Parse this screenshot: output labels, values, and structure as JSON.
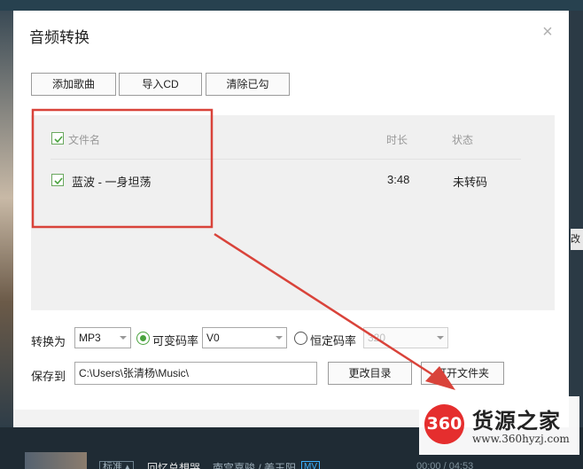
{
  "dialog": {
    "title": "音频转换",
    "close_glyph": "×"
  },
  "toolbar": {
    "add_song": "添加歌曲",
    "import_cd": "导入CD",
    "clear_checked": "清除已勾"
  },
  "file_list": {
    "columns": {
      "name": "文件名",
      "duration": "时长",
      "status": "状态"
    },
    "header_checked": true,
    "rows": [
      {
        "checked": true,
        "name": "蓝波 - 一身坦荡",
        "duration": "3:48",
        "status": "未转码"
      }
    ]
  },
  "convert": {
    "label": "转换为",
    "format": "MP3",
    "vbr_label": "可变码率",
    "vbr_selected": true,
    "vbr_value": "V0",
    "cbr_label": "恒定码率",
    "cbr_selected": false,
    "cbr_value": "320"
  },
  "save": {
    "label": "保存到",
    "path": "C:\\Users\\张清杨\\Music\\",
    "change_dir": "更改目录",
    "open_folder": "打开文件夹"
  },
  "background": {
    "right_fragment": "改",
    "quality_badge": "标准 ▴",
    "song": "回忆总想哭",
    "artist": "南宫嘉骏 / 姜玉阳",
    "mv_badge": "MV",
    "time": "00:00 / 04:53"
  },
  "watermark": {
    "logo": "360",
    "name": "货源之家",
    "url": "www.360hyzj.com"
  },
  "colors": {
    "accent_green": "#4aa33e",
    "annotation_red": "#d9433a",
    "list_bg": "#f0f0f0"
  },
  "icons": {
    "checkbox": "check-icon",
    "close": "close-icon",
    "dropdown": "chevron-down-icon"
  }
}
